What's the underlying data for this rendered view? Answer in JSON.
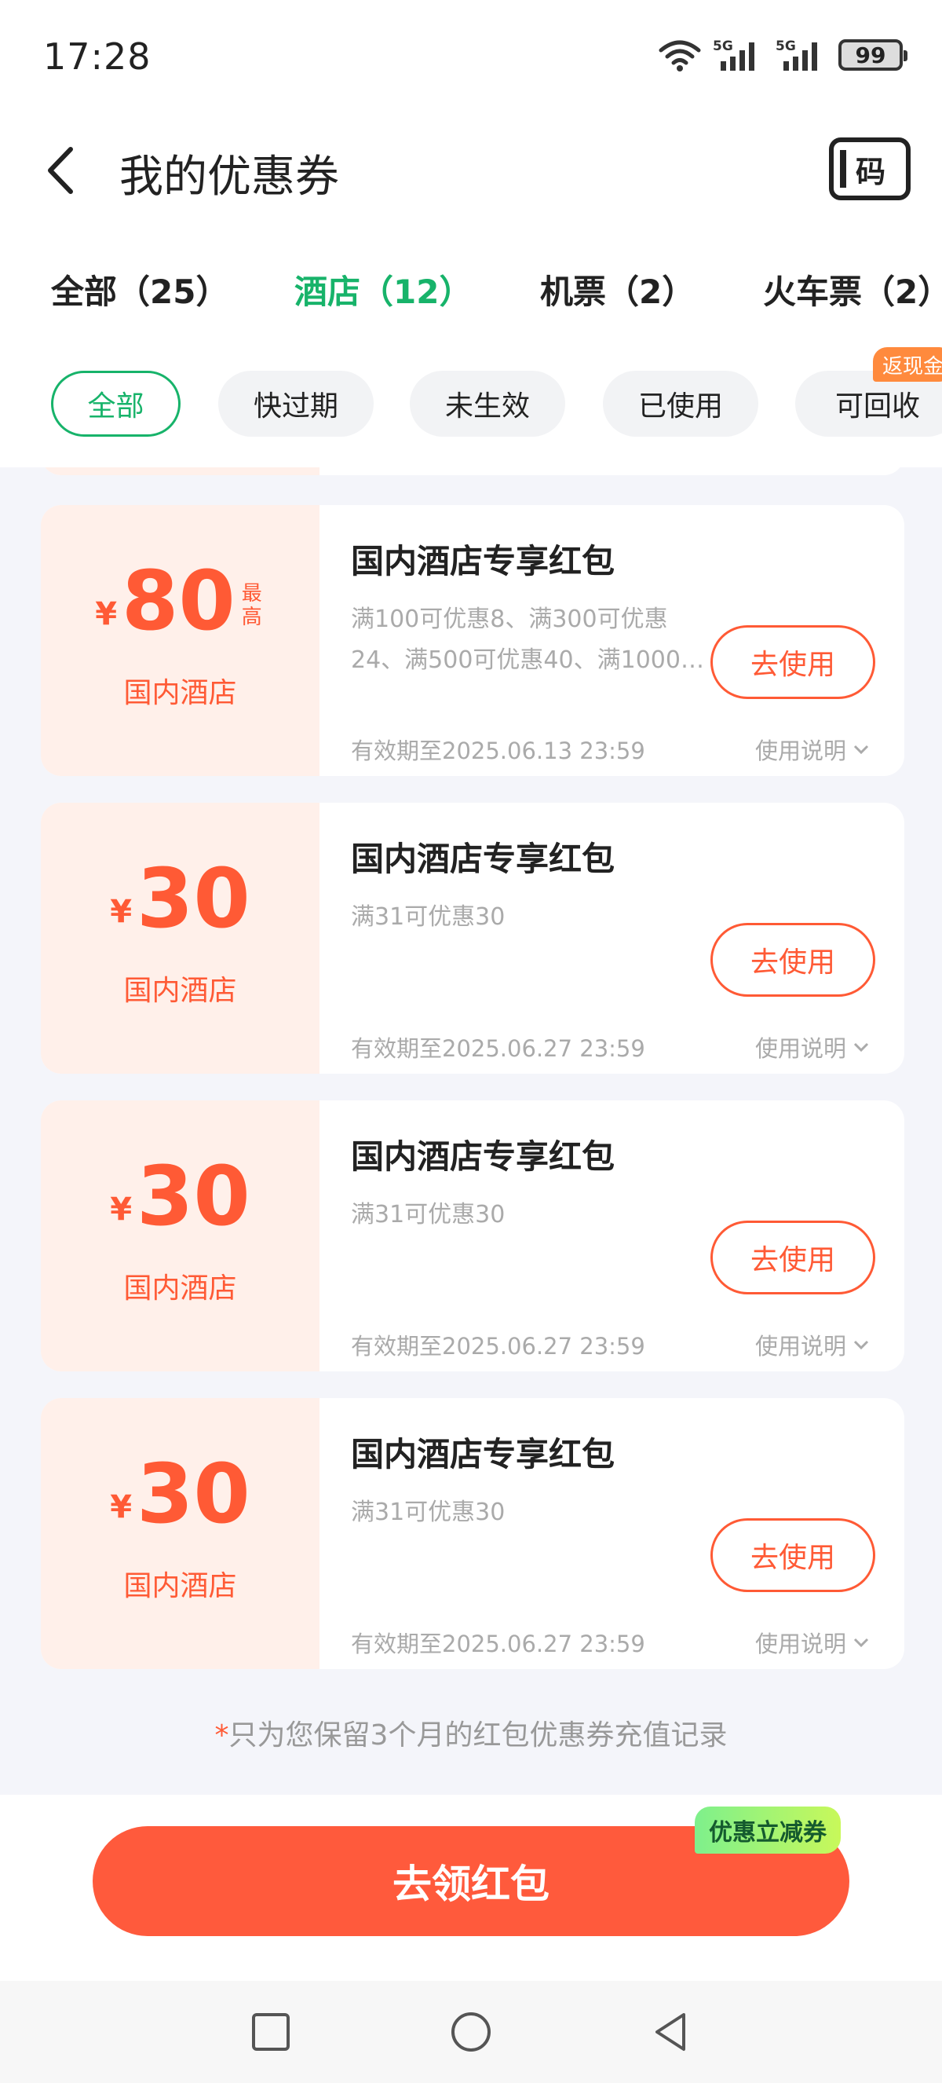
{
  "status": {
    "time": "17:28",
    "battery": "99"
  },
  "header": {
    "title": "我的优惠券"
  },
  "tabs": [
    {
      "label": "全部（25）"
    },
    {
      "label": "酒店（12）"
    },
    {
      "label": "机票（2）"
    },
    {
      "label": "火车票（2）"
    }
  ],
  "filters": [
    {
      "label": "全部"
    },
    {
      "label": "快过期"
    },
    {
      "label": "未生效"
    },
    {
      "label": "已使用"
    },
    {
      "label": "可回收"
    }
  ],
  "filter_badge": "返现金",
  "coupons": [
    {
      "currency": "¥",
      "amount": "80",
      "max_tag": "最高",
      "scope": "国内酒店",
      "title": "国内酒店专享红包",
      "desc": "满100可优惠8、满300可优惠24、满500可优惠40、满1000…",
      "button": "去使用",
      "expiry": "有效期至2025.06.13 23:59",
      "usage": "使用说明"
    },
    {
      "currency": "¥",
      "amount": "30",
      "scope": "国内酒店",
      "title": "国内酒店专享红包",
      "desc": "满31可优惠30",
      "button": "去使用",
      "expiry": "有效期至2025.06.27 23:59",
      "usage": "使用说明"
    },
    {
      "currency": "¥",
      "amount": "30",
      "scope": "国内酒店",
      "title": "国内酒店专享红包",
      "desc": "满31可优惠30",
      "button": "去使用",
      "expiry": "有效期至2025.06.27 23:59",
      "usage": "使用说明"
    },
    {
      "currency": "¥",
      "amount": "30",
      "scope": "国内酒店",
      "title": "国内酒店专享红包",
      "desc": "满31可优惠30",
      "button": "去使用",
      "expiry": "有效期至2025.06.27 23:59",
      "usage": "使用说明"
    }
  ],
  "footer_note": {
    "star": "*",
    "text": "只为您保留3个月的红包优惠券充值记录"
  },
  "cta": {
    "label": "去领红包",
    "badge": "优惠立减券"
  },
  "colors": {
    "accent_green": "#17b36a",
    "accent_red": "#ff5a35",
    "coupon_bg": "#fff0ea"
  },
  "icons": [
    "back-icon",
    "wifi-icon",
    "signal-5g-icon",
    "battery-icon",
    "barcode-icon",
    "chevron-down-icon",
    "nav-square-icon",
    "nav-circle-icon",
    "nav-back-icon"
  ]
}
